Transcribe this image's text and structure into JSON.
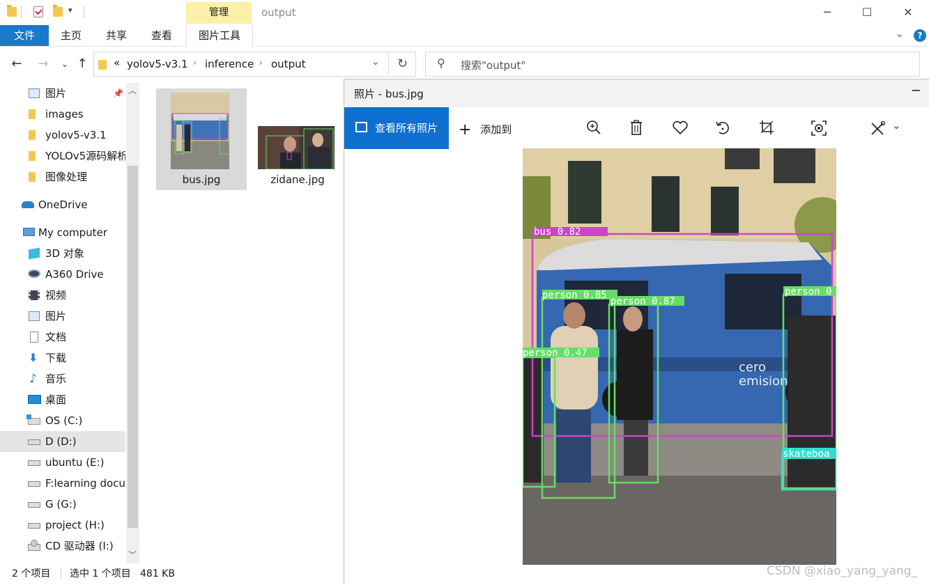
{
  "titlebar": {
    "manage_tab": "管理",
    "folder_title": "output",
    "minimize": "─",
    "maximize": "☐",
    "close": "✕"
  },
  "ribbon": {
    "file": "文件",
    "home": "主页",
    "share": "共享",
    "view": "查看",
    "picture_tools": "图片工具"
  },
  "address": {
    "overflow": "«",
    "crumbs": [
      "yolov5-v3.1",
      "inference",
      "output"
    ],
    "search_placeholder": "搜索\"output\""
  },
  "navpane": {
    "items": [
      {
        "label": "图片",
        "icon": "pictures-icon",
        "pinned": true
      },
      {
        "label": "images",
        "icon": "folder-icon"
      },
      {
        "label": "yolov5-v3.1",
        "icon": "folder-icon"
      },
      {
        "label": "YOLOv5源码解析",
        "icon": "folder-icon"
      },
      {
        "label": "图像处理",
        "icon": "folder-icon"
      },
      {
        "label": "OneDrive",
        "icon": "cloud-icon"
      },
      {
        "label": "My computer",
        "icon": "computer-icon"
      },
      {
        "label": "3D 对象",
        "icon": "cube-icon"
      },
      {
        "label": "A360 Drive",
        "icon": "drive-icon"
      },
      {
        "label": "视频",
        "icon": "video-icon"
      },
      {
        "label": "图片",
        "icon": "pictures-icon"
      },
      {
        "label": "文档",
        "icon": "document-icon"
      },
      {
        "label": "下载",
        "icon": "download-icon"
      },
      {
        "label": "音乐",
        "icon": "music-icon"
      },
      {
        "label": "桌面",
        "icon": "desktop-icon"
      },
      {
        "label": "OS (C:)",
        "icon": "windows-drive-icon"
      },
      {
        "label": "D (D:)",
        "icon": "drive-icon",
        "selected": true
      },
      {
        "label": "ubuntu (E:)",
        "icon": "drive-icon"
      },
      {
        "label": "F:learning documents",
        "icon": "drive-icon"
      },
      {
        "label": "G (G:)",
        "icon": "drive-icon"
      },
      {
        "label": "project (H:)",
        "icon": "drive-icon"
      },
      {
        "label": "CD 驱动器 (I:)",
        "icon": "cd-drive-icon"
      }
    ]
  },
  "files": [
    {
      "name": "bus.jpg",
      "selected": true
    },
    {
      "name": "zidane.jpg",
      "selected": false
    }
  ],
  "status": {
    "count": "2 个项目",
    "selected": "选中 1 个项目",
    "size": "481 KB"
  },
  "photos": {
    "title": "照片 - bus.jpg",
    "see_all": "查看所有照片",
    "add_to": "添加到",
    "toolbar_icons": [
      "zoom-in-icon",
      "delete-icon",
      "favorite-icon",
      "rotate-icon",
      "crop-icon",
      "enhance-icon",
      "edit-icon"
    ],
    "detections": [
      {
        "label": "bus 0.82",
        "color": "#cc44cc"
      },
      {
        "label": "person 0.85",
        "color": "#66dd66"
      },
      {
        "label": "person 0.87",
        "color": "#66dd66"
      },
      {
        "label": "person 0.47",
        "color": "#66dd66"
      },
      {
        "label": "person 0",
        "color": "#66dd66"
      },
      {
        "label": "skateboa",
        "color": "#33ddcc"
      }
    ]
  },
  "watermark": "CSDN @xiao_yang_yang_"
}
